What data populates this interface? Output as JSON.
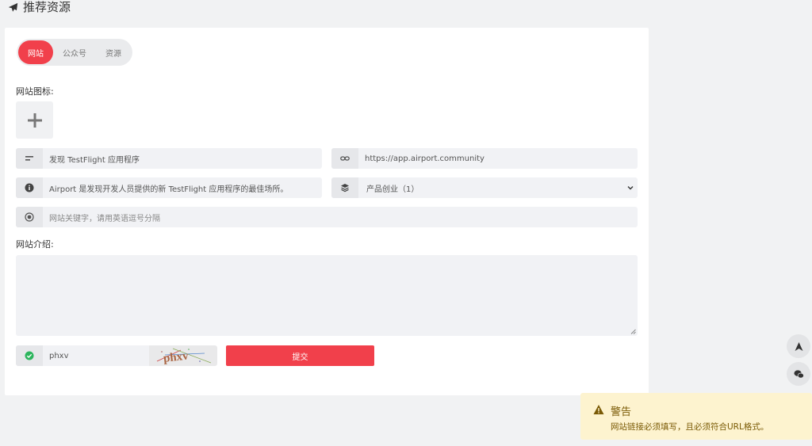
{
  "header": {
    "title": "推荐资源",
    "icon": "paper-plane-icon"
  },
  "tabs": [
    {
      "label": "网站",
      "active": true
    },
    {
      "label": "公众号",
      "active": false
    },
    {
      "label": "资源",
      "active": false
    }
  ],
  "form": {
    "icon_label": "网站图标:",
    "site_name": {
      "value": "发现 TestFlight 应用程序",
      "icon": "text-align-icon"
    },
    "site_url": {
      "value": "https://app.airport.community",
      "icon": "link-icon"
    },
    "description": {
      "value": "Airport 是发现开发人员提供的新 TestFlight 应用程序的最佳场所。",
      "icon": "info-icon"
    },
    "category": {
      "value": "产品创业（1）",
      "icon": "layers-icon"
    },
    "keywords": {
      "placeholder": "网站关键字，请用英语逗号分隔",
      "icon": "target-icon"
    },
    "intro_label": "网站介绍:",
    "captcha": {
      "value": "phxv",
      "icon": "check-circle-icon",
      "image_text": "phxv"
    },
    "submit_label": "提交"
  },
  "colors": {
    "accent": "#f1404b",
    "warning_bg": "#fdf3cf",
    "warning_text": "#7a5a05",
    "success": "#2db55d"
  },
  "side_buttons": [
    "arrow-up-icon",
    "wechat-icon"
  ],
  "toast": {
    "title": "警告",
    "message": "网站链接必须填写，且必须符合URL格式。",
    "icon": "warning-icon"
  }
}
